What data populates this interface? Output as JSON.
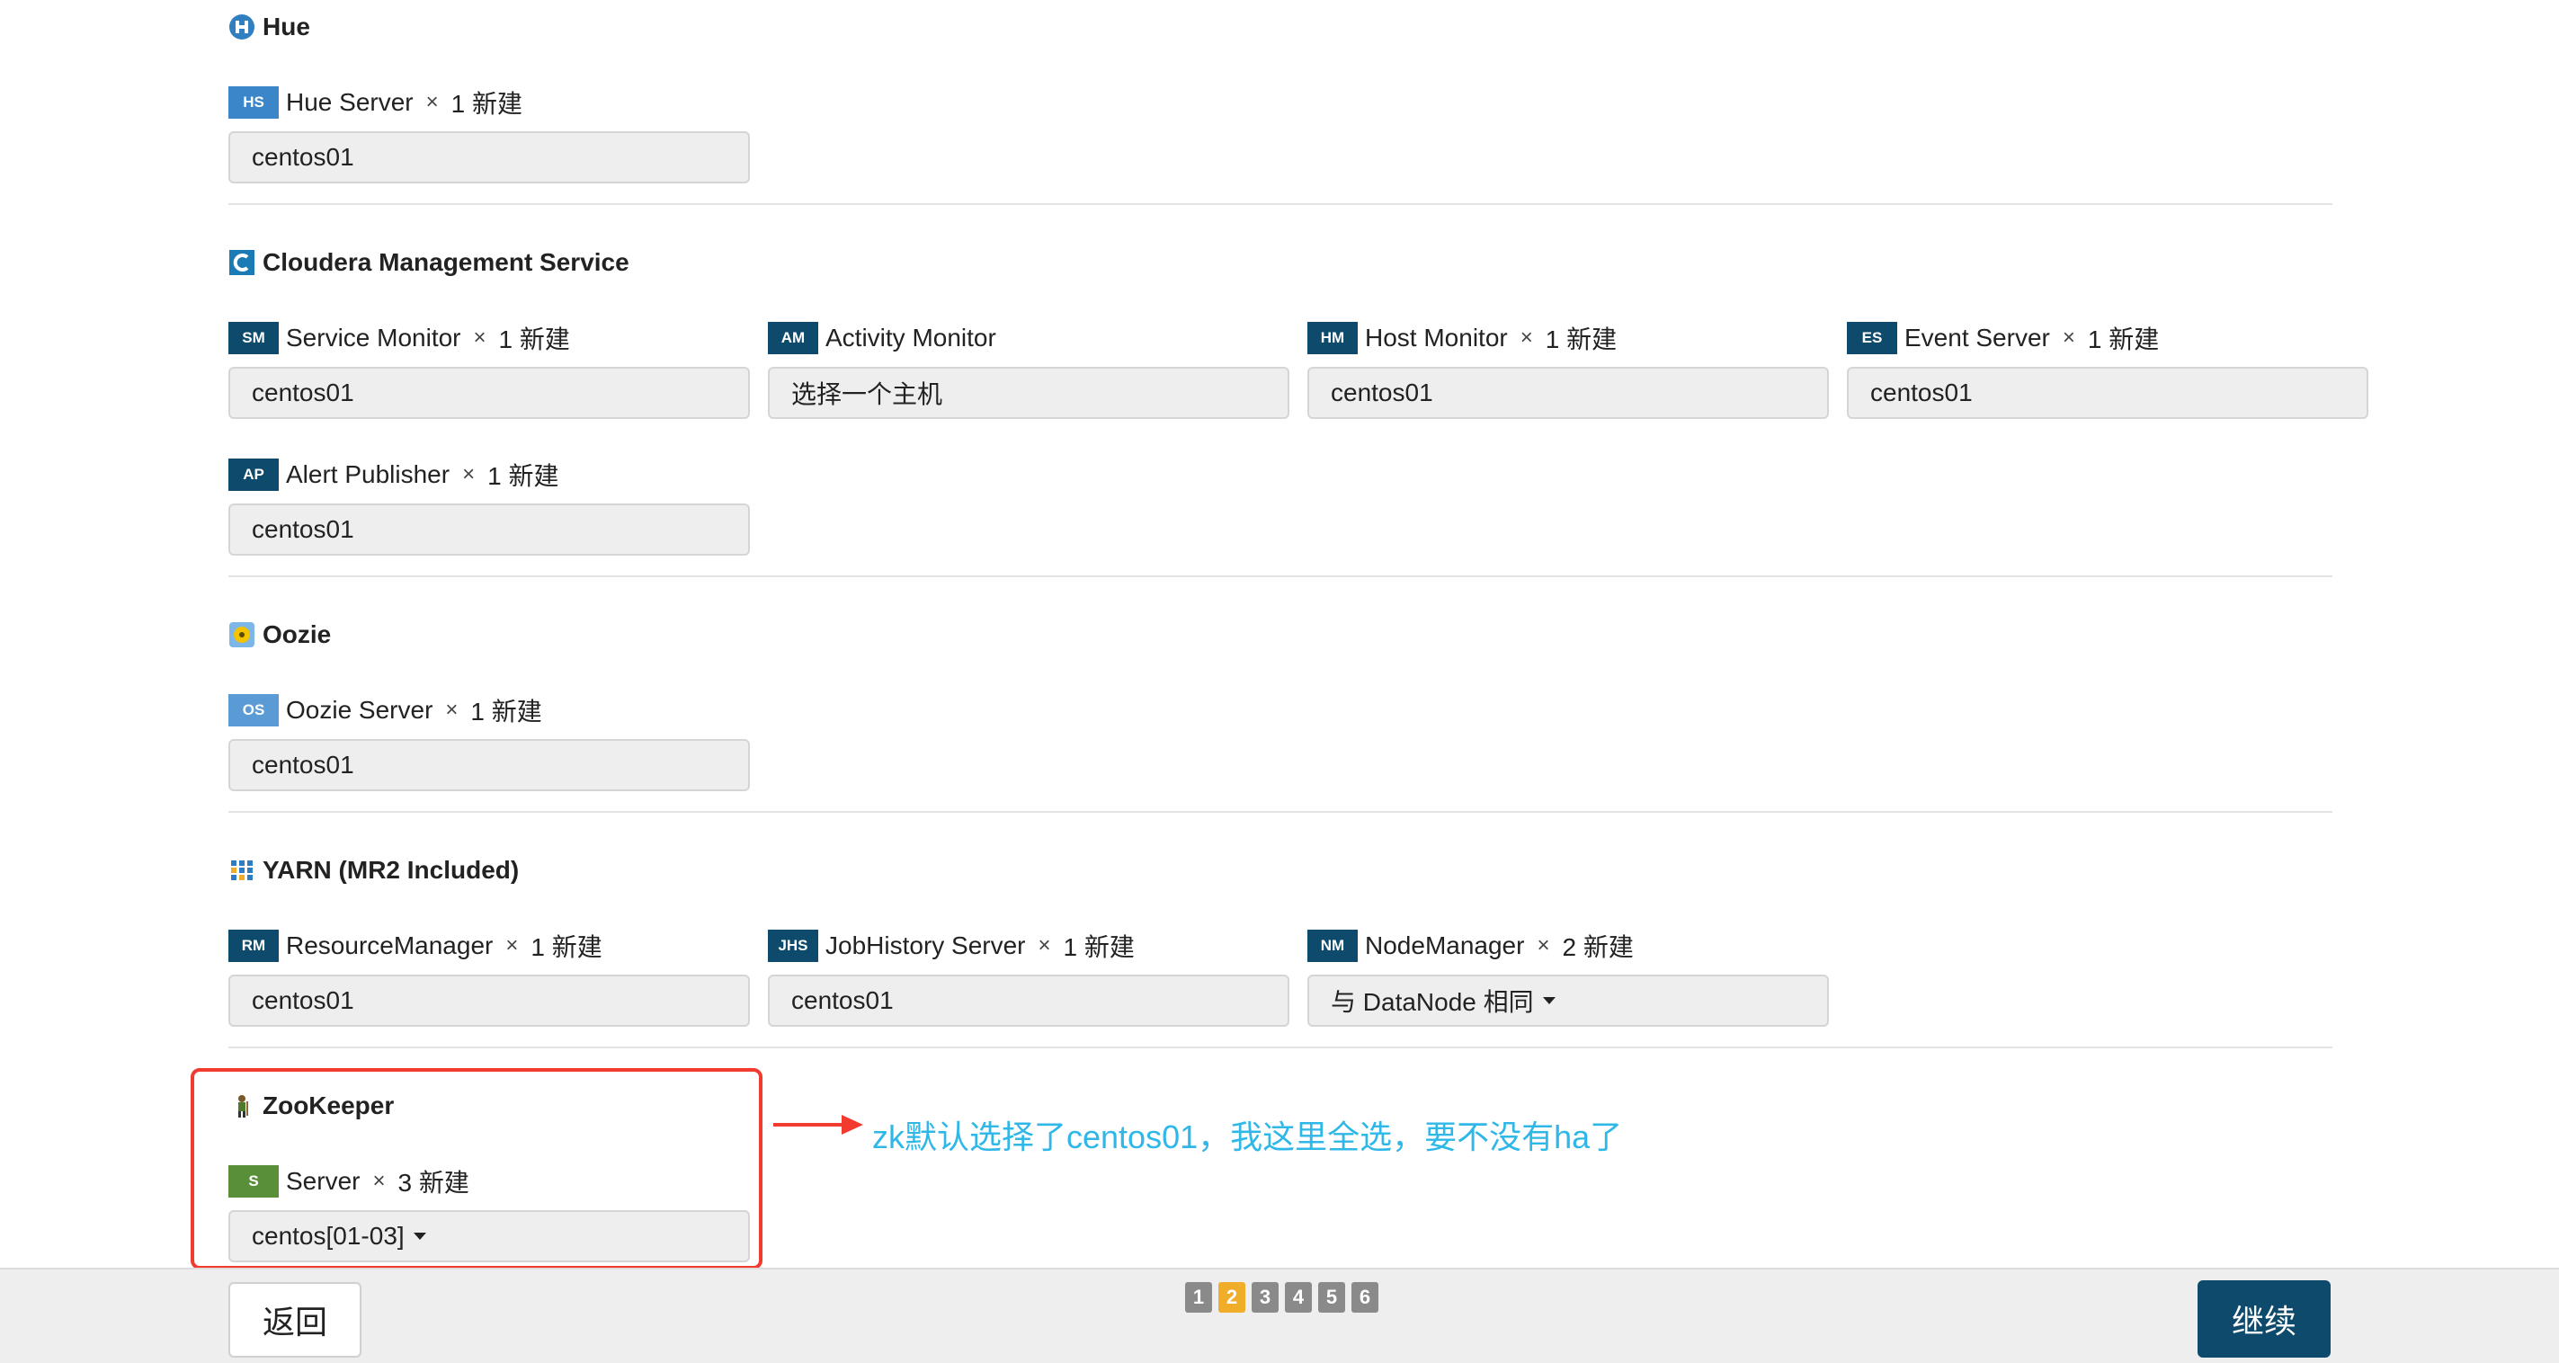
{
  "services": [
    {
      "title": "Hue",
      "icon": "hue-icon",
      "roles": [
        {
          "abbr": "HS",
          "name": "Hue Server",
          "x": "×",
          "count": "1 新建",
          "host": "centos01",
          "color": "#3a86c8"
        }
      ]
    },
    {
      "title": "Cloudera Management Service",
      "icon": "cloudera-icon",
      "roles": [
        {
          "abbr": "SM",
          "name": "Service Monitor",
          "x": "×",
          "count": "1 新建",
          "host": "centos01",
          "color": "#0e4a6b"
        },
        {
          "abbr": "AM",
          "name": "Activity Monitor",
          "x": "",
          "count": "",
          "host": "选择一个主机",
          "color": "#0e4a6b"
        },
        {
          "abbr": "HM",
          "name": "Host Monitor",
          "x": "×",
          "count": "1 新建",
          "host": "centos01",
          "color": "#0e4a6b"
        },
        {
          "abbr": "ES",
          "name": "Event Server",
          "x": "×",
          "count": "1 新建",
          "host": "centos01",
          "color": "#0e4a6b"
        },
        {
          "abbr": "AP",
          "name": "Alert Publisher",
          "x": "×",
          "count": "1 新建",
          "host": "centos01",
          "color": "#0e4a6b"
        }
      ]
    },
    {
      "title": "Oozie",
      "icon": "oozie-icon",
      "roles": [
        {
          "abbr": "OS",
          "name": "Oozie Server",
          "x": "×",
          "count": "1 新建",
          "host": "centos01",
          "color": "#5b9bd5"
        }
      ]
    },
    {
      "title": "YARN (MR2 Included)",
      "icon": "yarn-icon",
      "roles": [
        {
          "abbr": "RM",
          "name": "ResourceManager",
          "x": "×",
          "count": "1 新建",
          "host": "centos01",
          "color": "#0e4a6b"
        },
        {
          "abbr": "JHS",
          "name": "JobHistory Server",
          "x": "×",
          "count": "1 新建",
          "host": "centos01",
          "color": "#0e4a6b"
        },
        {
          "abbr": "NM",
          "name": "NodeManager",
          "x": "×",
          "count": "2 新建",
          "host": "与 DataNode 相同",
          "color": "#0e4a6b"
        }
      ]
    },
    {
      "title": "ZooKeeper",
      "icon": "zookeeper-icon",
      "roles": [
        {
          "abbr": "S",
          "name": "Server",
          "x": "×",
          "count": "3 新建",
          "host": "centos[01-03]",
          "color": "#5a8f3a"
        }
      ]
    }
  ],
  "annotation": {
    "text": "zk默认选择了centos01，我这里全选，要不没有ha了",
    "color": "#2fb7e8",
    "highlight_color": "#f23b2e"
  },
  "footer": {
    "back_label": "返回",
    "continue_label": "继续",
    "steps": [
      "1",
      "2",
      "3",
      "4",
      "5",
      "6"
    ],
    "active_step": "2"
  }
}
